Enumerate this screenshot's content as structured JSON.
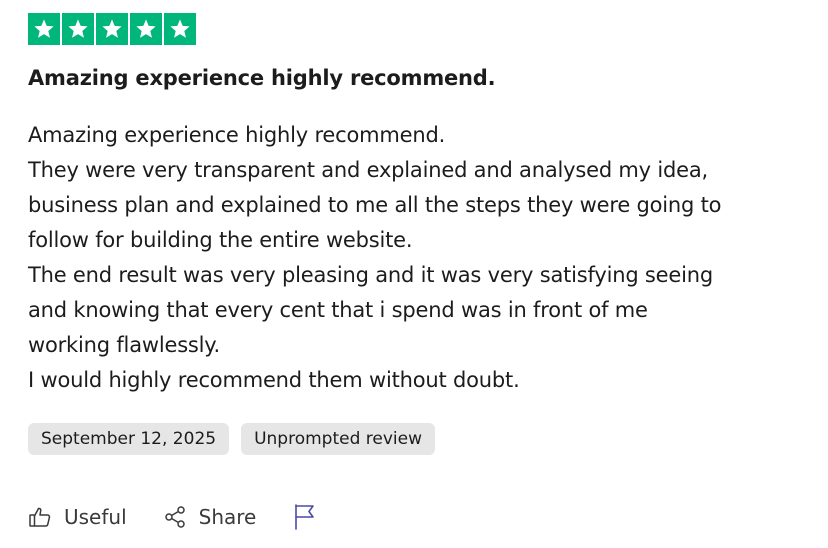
{
  "review": {
    "rating": {
      "value": 5,
      "max": 5,
      "color": "#00b67a"
    },
    "title": "Amazing experience highly recommend.",
    "body_lines": [
      "Amazing experience highly recommend.",
      "They were very transparent and explained and analysed my idea,",
      "business plan and explained to me all the steps they were going to",
      "follow for building the entire website.",
      "The end result was very pleasing and it was very satisfying seeing",
      "and knowing that every cent that i spend was in front of me",
      "working flawlessly.",
      "I would highly recommend them without doubt."
    ],
    "tags": {
      "date": "September 12, 2025",
      "type": "Unprompted review"
    },
    "actions": {
      "useful": {
        "label": "Useful",
        "icon": "thumbs-up-icon"
      },
      "share": {
        "label": "Share",
        "icon": "share-icon"
      },
      "report": {
        "icon": "flag-icon"
      }
    }
  }
}
